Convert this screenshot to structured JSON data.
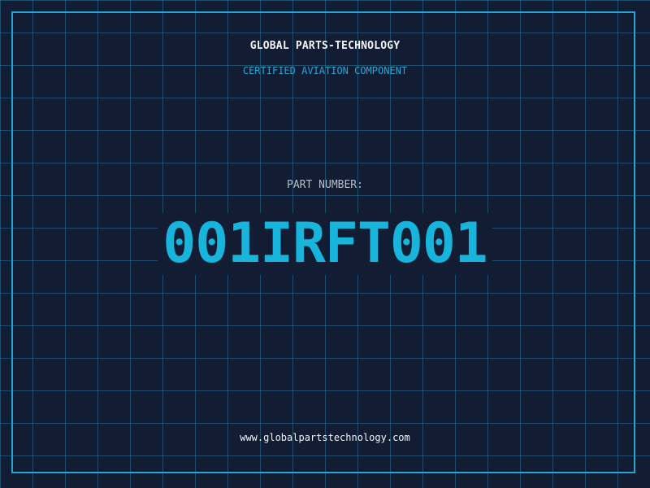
{
  "header": {
    "company": "GLOBAL PARTS-TECHNOLOGY",
    "tagline": "CERTIFIED AVIATION COMPONENT"
  },
  "part": {
    "label": "PART NUMBER:",
    "number": "001IRFT001"
  },
  "footer": {
    "url": "www.globalpartstechnology.com"
  },
  "colors": {
    "background": "#121c33",
    "grid": "#267696",
    "accent": "#17b4dc",
    "frame": "#27a5d0",
    "text": "#f2f4f7",
    "muted": "#b7bdc8"
  }
}
